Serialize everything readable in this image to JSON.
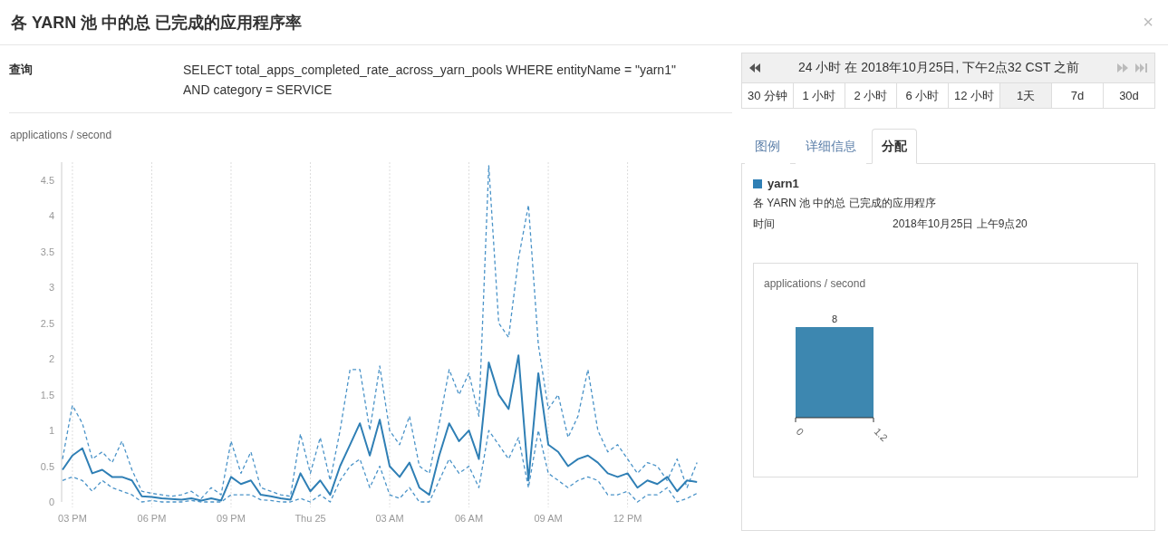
{
  "dialog": {
    "title": "各 YARN 池 中的总 已完成的应用程序率",
    "close": "×"
  },
  "query": {
    "label": "查询",
    "text": "SELECT total_apps_completed_rate_across_yarn_pools WHERE entityName = \"yarn1\" AND category = SERVICE"
  },
  "time_range": {
    "text": "24 小时 在 2018年10月25日, 下午2点32 CST 之前",
    "options": [
      {
        "label": "30 分钟",
        "selected": false
      },
      {
        "label": "1 小时",
        "selected": false
      },
      {
        "label": "2 小时",
        "selected": false
      },
      {
        "label": "6 小时",
        "selected": false
      },
      {
        "label": "12 小时",
        "selected": false
      },
      {
        "label": "1天",
        "selected": true
      },
      {
        "label": "7d",
        "selected": false
      },
      {
        "label": "30d",
        "selected": false
      }
    ]
  },
  "chart": {
    "chart_data": {
      "type": "line",
      "ylabel": "applications / second",
      "ylim": [
        0,
        4.75
      ],
      "grid": true,
      "categories": [
        null,
        "03 PM",
        null,
        null,
        null,
        null,
        null,
        null,
        null,
        "06 PM",
        null,
        null,
        null,
        null,
        null,
        null,
        null,
        "09 PM",
        null,
        null,
        null,
        null,
        null,
        null,
        null,
        "Thu 25",
        null,
        null,
        null,
        null,
        null,
        null,
        null,
        "03 AM",
        null,
        null,
        null,
        null,
        null,
        null,
        null,
        "06 AM",
        null,
        null,
        null,
        null,
        null,
        null,
        null,
        "09 AM",
        null,
        null,
        null,
        null,
        null,
        null,
        null,
        "12 PM",
        null,
        null,
        null,
        null,
        null,
        null,
        null
      ],
      "yticks": [
        0,
        0.5,
        1,
        1.5,
        2,
        2.5,
        3,
        3.5,
        4,
        4.5
      ],
      "series": [
        {
          "color": "#4a93c8",
          "line_style": "dashed",
          "values": [
            0.6,
            1.35,
            1.1,
            0.6,
            0.7,
            0.55,
            0.85,
            0.45,
            0.15,
            0.12,
            0.1,
            0.08,
            0.1,
            0.15,
            0.05,
            0.2,
            0.1,
            0.85,
            0.4,
            0.7,
            0.2,
            0.15,
            0.1,
            0.08,
            0.95,
            0.4,
            0.9,
            0.3,
            1.0,
            1.85,
            1.85,
            1.0,
            1.9,
            1.0,
            0.8,
            1.2,
            0.5,
            0.4,
            1.1,
            1.85,
            1.5,
            1.8,
            1.2,
            4.7,
            2.5,
            2.3,
            3.4,
            4.15,
            2.2,
            1.3,
            1.5,
            0.9,
            1.2,
            1.85,
            1.0,
            0.7,
            0.8,
            0.6,
            0.4,
            0.55,
            0.5,
            0.3,
            0.6,
            0.2,
            0.55
          ]
        },
        {
          "color": "#2f7fb5",
          "line_style": "solid",
          "values": [
            0.45,
            0.65,
            0.75,
            0.4,
            0.45,
            0.35,
            0.35,
            0.3,
            0.08,
            0.07,
            0.05,
            0.04,
            0.03,
            0.05,
            0.02,
            0.05,
            0.02,
            0.35,
            0.25,
            0.3,
            0.1,
            0.08,
            0.05,
            0.03,
            0.4,
            0.15,
            0.3,
            0.1,
            0.5,
            0.8,
            1.1,
            0.65,
            1.15,
            0.5,
            0.35,
            0.55,
            0.2,
            0.1,
            0.65,
            1.1,
            0.85,
            1.0,
            0.6,
            1.95,
            1.5,
            1.3,
            2.05,
            0.3,
            1.8,
            0.8,
            0.7,
            0.5,
            0.6,
            0.65,
            0.55,
            0.4,
            0.35,
            0.4,
            0.2,
            0.3,
            0.25,
            0.35,
            0.15,
            0.3,
            0.28
          ]
        },
        {
          "color": "#4a93c8",
          "line_style": "dashed",
          "values": [
            0.3,
            0.35,
            0.3,
            0.15,
            0.3,
            0.2,
            0.15,
            0.1,
            0,
            0.02,
            0,
            0,
            0,
            0.02,
            0,
            0,
            0,
            0.1,
            0.1,
            0.1,
            0.03,
            0.02,
            0,
            0,
            0.05,
            0,
            0.1,
            0,
            0.3,
            0.5,
            0.6,
            0.2,
            0.5,
            0.1,
            0.05,
            0.2,
            0,
            0,
            0.3,
            0.6,
            0.4,
            0.5,
            0.2,
            1.0,
            0.8,
            0.6,
            0.9,
            0.2,
            1.0,
            0.4,
            0.3,
            0.2,
            0.3,
            0.35,
            0.3,
            0.1,
            0.1,
            0.15,
            0,
            0.1,
            0.1,
            0.2,
            0,
            0.05,
            0.12
          ]
        }
      ]
    }
  },
  "tabs": [
    {
      "label": "图例",
      "selected": false
    },
    {
      "label": "详细信息",
      "selected": false
    },
    {
      "label": "分配",
      "selected": true
    }
  ],
  "legend": {
    "name": "yarn1",
    "color": "#2f7fb5",
    "description": "各 YARN 池 中的总 已完成的应用程序",
    "time_label": "时间",
    "time_value": "2018年10月25日 上午9点20"
  },
  "distribution": {
    "title": "applications / second",
    "bar_label": "8",
    "bin_edges": [
      "0",
      "1.2"
    ]
  }
}
